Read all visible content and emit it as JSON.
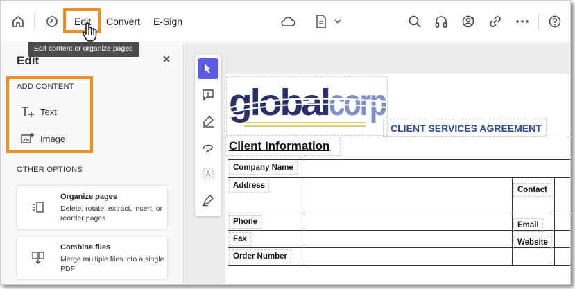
{
  "menu": {
    "edit": "Edit",
    "convert": "Convert",
    "esign": "E-Sign"
  },
  "tooltip": "Edit content or organize pages",
  "panel": {
    "title": "Edit",
    "add_content_label": "ADD CONTENT",
    "text_label": "Text",
    "image_label": "Image",
    "other_options_label": "OTHER OPTIONS",
    "cards": [
      {
        "title": "Organize pages",
        "desc": "Delete, rotate, extract, insert, or reorder pages"
      },
      {
        "title": "Combine files",
        "desc": "Merge multiple files into a single PDF"
      }
    ]
  },
  "document": {
    "logo_text": "globalcorp",
    "agreement_title": "CLIENT SERVICES AGREEMENT",
    "section_title": "Client Information",
    "fields": {
      "company_name": "Company Name",
      "address": "Address",
      "contact": "Contact",
      "phone": "Phone",
      "email": "Email",
      "fax": "Fax",
      "website": "Website",
      "order_number": "Order Number"
    }
  },
  "colors": {
    "highlight": "#f28c1b",
    "tool_active": "#5b5be8",
    "agreement_blue": "#2c4a9a",
    "logo_navy": "#2a2f6b",
    "logo_blue": "#7d8fc4"
  },
  "icons": [
    "home-icon",
    "recent-icon",
    "cloud-icon",
    "document-icon",
    "search-icon",
    "headphones-icon",
    "add-user-icon",
    "link-icon",
    "more-icon",
    "help-icon",
    "close-icon",
    "add-text-icon",
    "add-image-icon",
    "organize-pages-icon",
    "combine-files-icon",
    "select-tool-icon",
    "comment-icon",
    "highlight-icon",
    "draw-icon",
    "text-recognition-icon",
    "sign-icon",
    "hand-cursor-icon"
  ]
}
